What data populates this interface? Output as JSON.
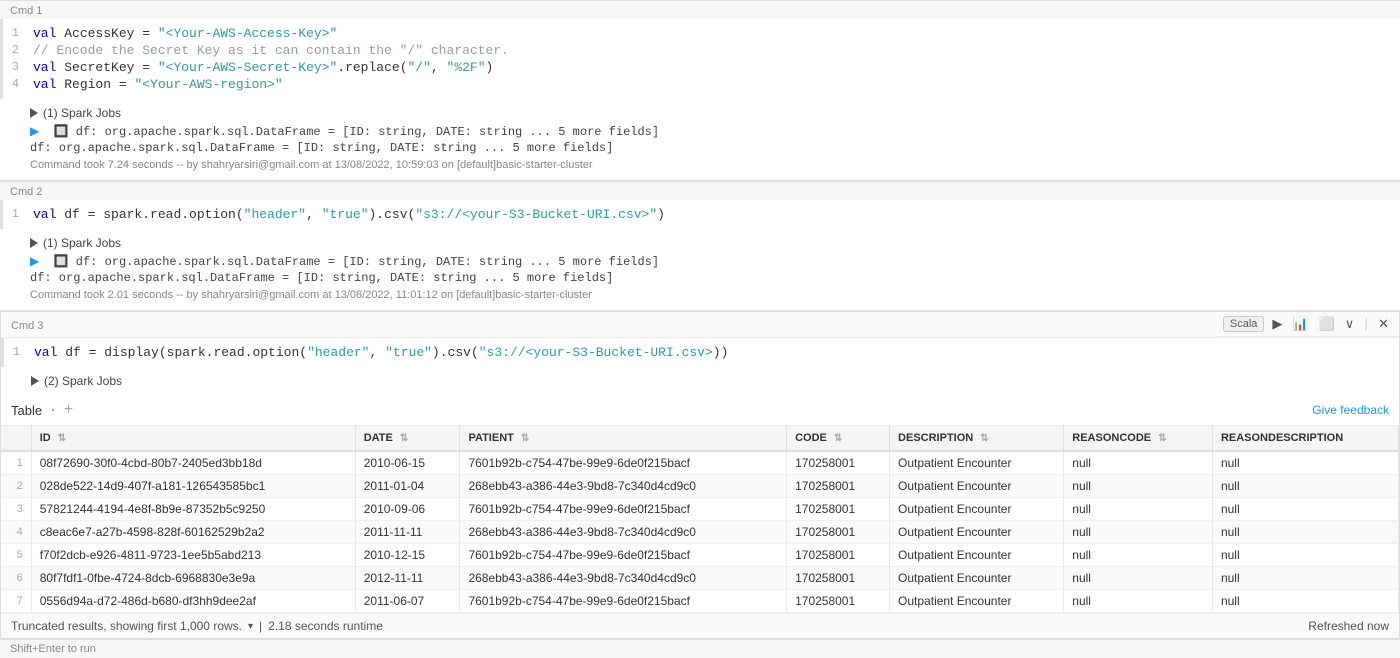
{
  "cmd1": {
    "label": "Cmd 1",
    "lines": [
      {
        "num": "1",
        "html": "<span class='kw'>val</span> <span class='var-name'>AccessKey</span> = <span class='str'>\"&lt;Your-AWS-Access-Key&gt;\"</span>"
      },
      {
        "num": "2",
        "html": "<span class='comment'>// Encode the Secret Key as it can contain the \"/\" character.</span>"
      },
      {
        "num": "3",
        "html": "<span class='kw'>val</span> <span class='var-name'>SecretKey</span> = <span class='str'>\"&lt;Your-AWS-Secret-Key&gt;\"</span>.replace(<span class='str'>\"/\"</span>, <span class='str'>\"%2F\"</span>)"
      },
      {
        "num": "4",
        "html": "<span class='kw'>val</span> <span class='var-name'>Region</span> = <span class='str'>\"&lt;Your-AWS-region&gt;\"</span>"
      }
    ],
    "spark_jobs": "(1) Spark Jobs",
    "df_spark": "▶  🔲 df: org.apache.spark.sql.DataFrame = [ID: string, DATE: string ... 5 more fields]",
    "df_output": "df: org.apache.spark.sql.DataFrame = [ID: string, DATE: string ... 5 more fields]",
    "timing": "Command took 7.24 seconds -- by shahryarsiri@gmail.com at 13/08/2022, 10:59:03 on [default]basic-starter-cluster"
  },
  "cmd2": {
    "label": "Cmd 2",
    "lines": [
      {
        "num": "1",
        "html": "<span class='kw'>val</span> <span class='var-name'>df</span> = spark.read.option(<span class='str'>\"header\"</span>, <span class='str'>\"true\"</span>).csv(<span class='str'>\"s3://&lt;your-S3-Bucket-URI.csv&gt;\"</span>)"
      }
    ],
    "spark_jobs": "(1) Spark Jobs",
    "df_spark": "▶  🔲 df: org.apache.spark.sql.DataFrame = [ID: string, DATE: string ... 5 more fields]",
    "df_output": "df: org.apache.spark.sql.DataFrame = [ID: string, DATE: string ... 5 more fields]",
    "timing": "Command took 2.01 seconds -- by shahryarsiri@gmail.com at 13/08/2022, 11:01:12 on [default]basic-starter-cluster"
  },
  "cmd3": {
    "label": "Cmd 3",
    "lines": [
      {
        "num": "1",
        "html": "<span class='kw'>val</span> <span class='var-name'>df</span> = display(spark.read.option(<span class='str'>\"header\"</span>, <span class='str'>\"true\"</span>).csv(<span class='str'>\"s3://&lt;your-S3-Bucket-URI.csv&gt;</span>))"
      }
    ],
    "spark_jobs": "(2) Spark Jobs",
    "scala_badge": "Scala",
    "run_btn": "▶",
    "close_btn": "✕",
    "tab_table": "Table",
    "tab_plus": "+",
    "give_feedback": "Give feedback",
    "table": {
      "columns": [
        "",
        "ID",
        "DATE",
        "PATIENT",
        "CODE",
        "DESCRIPTION",
        "REASONCODE",
        "REASONDESCRIPTION"
      ],
      "rows": [
        [
          "1",
          "08f72690-30f0-4cbd-80b7-2405ed3bb18d",
          "2010-06-15",
          "7601b92b-c754-47be-99e9-6de0f215bacf",
          "170258001",
          "Outpatient Encounter",
          "null",
          "null"
        ],
        [
          "2",
          "028de522-14d9-407f-a181-126543585bc1",
          "2011-01-04",
          "268ebb43-a386-44e3-9bd8-7c340d4cd9c0",
          "170258001",
          "Outpatient Encounter",
          "null",
          "null"
        ],
        [
          "3",
          "57821244-4194-4e8f-8b9e-87352b5c9250",
          "2010-09-06",
          "7601b92b-c754-47be-99e9-6de0f215bacf",
          "170258001",
          "Outpatient Encounter",
          "null",
          "null"
        ],
        [
          "4",
          "c8eac6e7-a27b-4598-828f-60162529b2a2",
          "2011-11-11",
          "268ebb43-a386-44e3-9bd8-7c340d4cd9c0",
          "170258001",
          "Outpatient Encounter",
          "null",
          "null"
        ],
        [
          "5",
          "f70f2dcb-e926-4811-9723-1ee5b5abd213",
          "2010-12-15",
          "7601b92b-c754-47be-99e9-6de0f215bacf",
          "170258001",
          "Outpatient Encounter",
          "null",
          "null"
        ],
        [
          "6",
          "80f7fdf1-0fbe-4724-8dcb-6968830e3e9a",
          "2012-11-11",
          "268ebb43-a386-44e3-9bd8-7c340d4cd9c0",
          "170258001",
          "Outpatient Encounter",
          "null",
          "null"
        ],
        [
          "7",
          "0556d94a-d72-486d-b680-df3hh9dee2af",
          "2011-06-07",
          "7601b92b-c754-47be-99e9-6de0f215bacf",
          "170258001",
          "Outpatient Encounter",
          "null",
          "null"
        ]
      ]
    },
    "footer": {
      "truncated": "Truncated results, showing first 1,000 rows.",
      "runtime": "2.18 seconds runtime",
      "refreshed": "Refreshed now"
    }
  },
  "bottom_bar": {
    "shortcut": "Shift+Enter to run"
  }
}
